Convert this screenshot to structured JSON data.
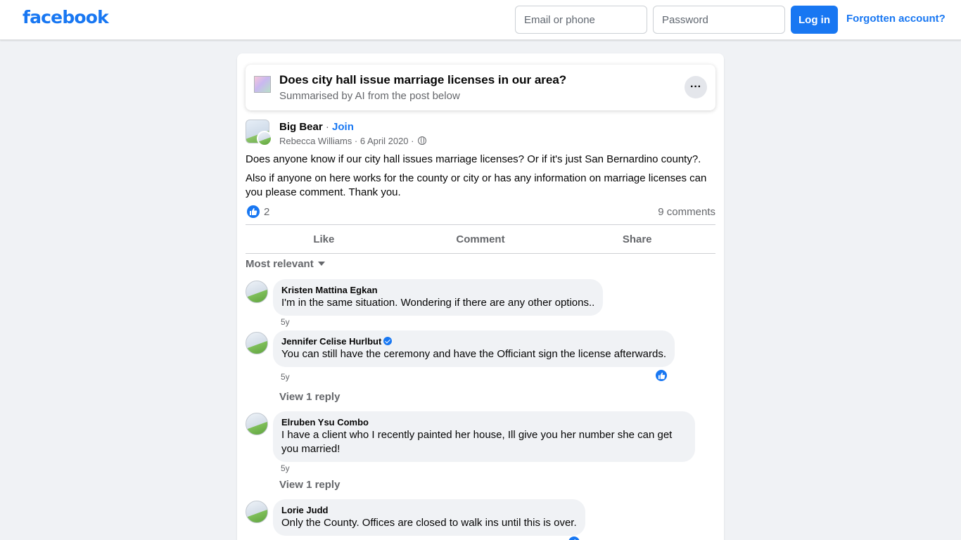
{
  "header": {
    "logo": "facebook",
    "email_placeholder": "Email or phone",
    "password_placeholder": "Password",
    "login_label": "Log in",
    "forgot_label": "Forgotten account?"
  },
  "ai_summary": {
    "title": "Does city hall issue marriage licenses in our area?",
    "subtitle": "Summarised by AI from the post below",
    "more_label": "···"
  },
  "post": {
    "group_name": "Big Bear",
    "separator": " · ",
    "join_label": "Join",
    "author": "Rebecca Williams",
    "date": "6 April 2020",
    "paragraphs": [
      "Does anyone know if our city hall issues marriage licenses? Or if it's just San Bernardino county?.",
      "Also if anyone on here works for the county or city or has any information on marriage licenses can you please comment. Thank you."
    ],
    "like_count": "2",
    "comment_count": "9 comments"
  },
  "actions": {
    "like": "Like",
    "comment": "Comment",
    "share": "Share"
  },
  "sort_label": "Most relevant",
  "comments": [
    {
      "name": "Kristen Mattina Egkan",
      "text": "I'm in the same situation. Wondering if there are any other options..",
      "time": "5y"
    },
    {
      "name": "Jennifer Celise Hurlbut",
      "text": "You can still have the ceremony and have the Officiant sign the license afterwards.",
      "time": "5y",
      "verified": true,
      "reply_label": "View 1 reply"
    },
    {
      "name": "Elruben Ysu Combo",
      "text": "I have a client who I recently painted her house, Ill give you her number she can get you married!",
      "time": "5y",
      "reply_label": "View 1 reply"
    },
    {
      "name": "Lorie Judd",
      "text": "Only the County. Offices are closed to walk ins until this is over."
    }
  ],
  "colors": {
    "brand": "#1877f2",
    "background": "#f0f2f5",
    "secondary_text": "#65676b"
  }
}
